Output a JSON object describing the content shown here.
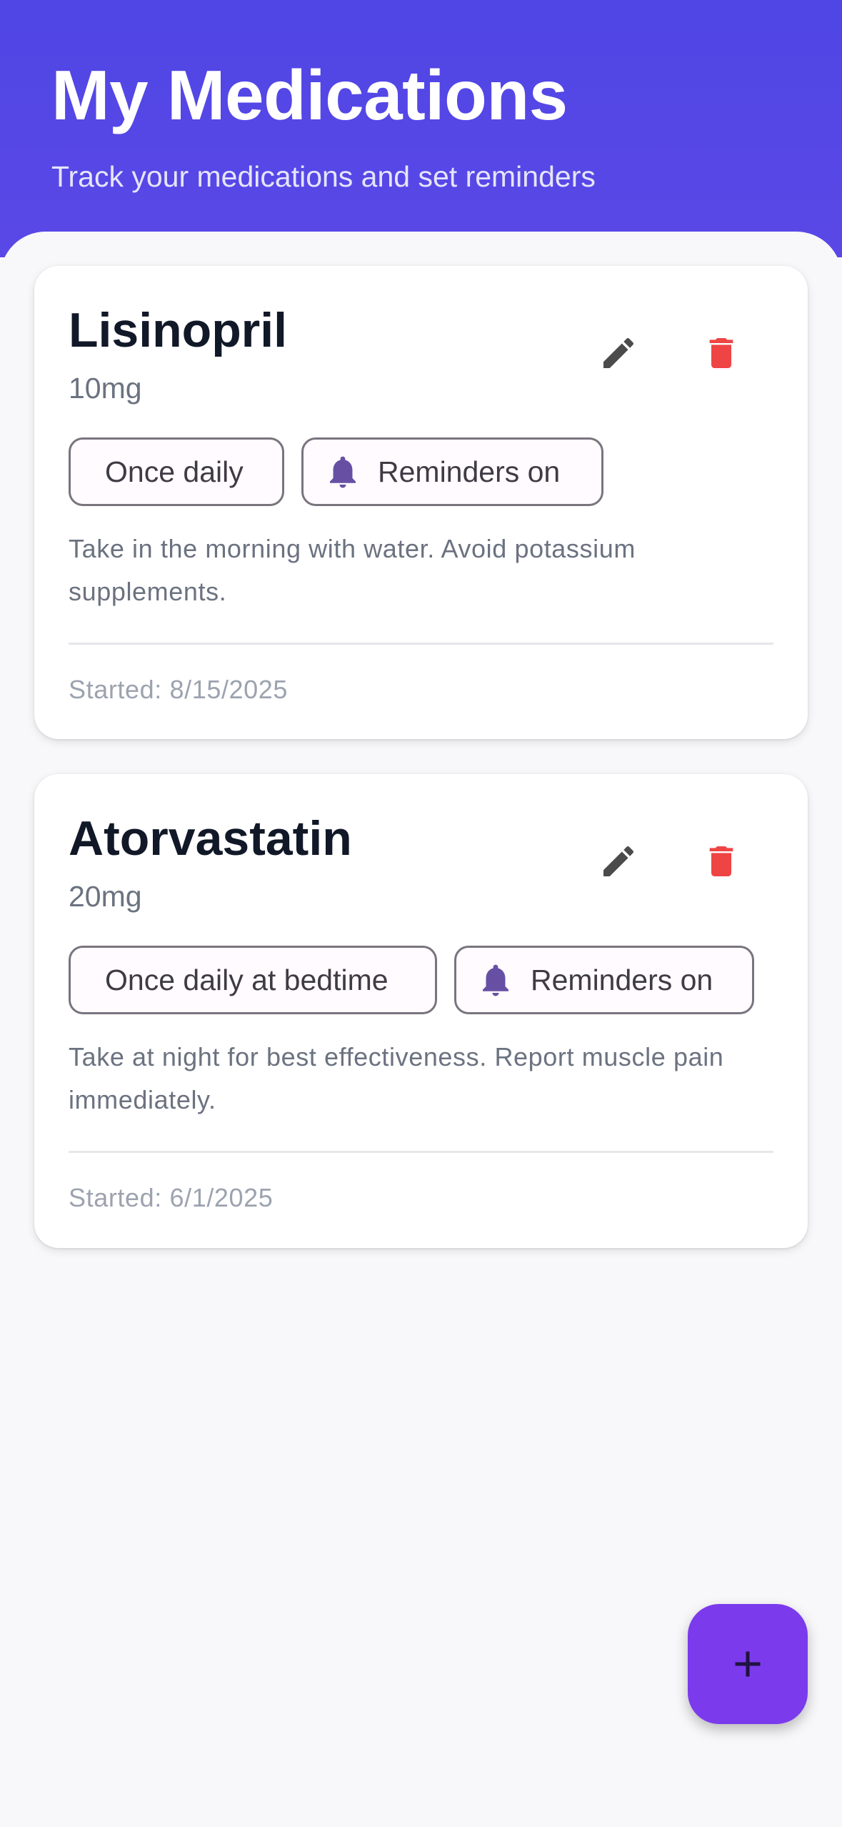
{
  "header": {
    "title": "My Medications",
    "subtitle": "Track your medications and set reminders"
  },
  "medications": [
    {
      "name": "Lisinopril",
      "dose": "10mg",
      "frequency": "Once daily",
      "reminders": "Reminders on",
      "notes": "Take in the morning with water. Avoid potassium supplements.",
      "started": "Started: 8/15/2025"
    },
    {
      "name": "Atorvastatin",
      "dose": "20mg",
      "frequency": "Once daily at bedtime",
      "reminders": "Reminders on",
      "notes": "Take at night for best effectiveness. Report muscle pain immediately.",
      "started": "Started: 6/1/2025"
    }
  ],
  "icons": {
    "edit": "pencil-icon",
    "delete": "trash-icon",
    "reminder": "bell-icon",
    "add": "plus-icon"
  },
  "colors": {
    "header": "#4f46e5",
    "fab": "#7c3aed",
    "delete": "#ef4444",
    "bell": "#6750a4",
    "edit": "#4b4b4b"
  }
}
